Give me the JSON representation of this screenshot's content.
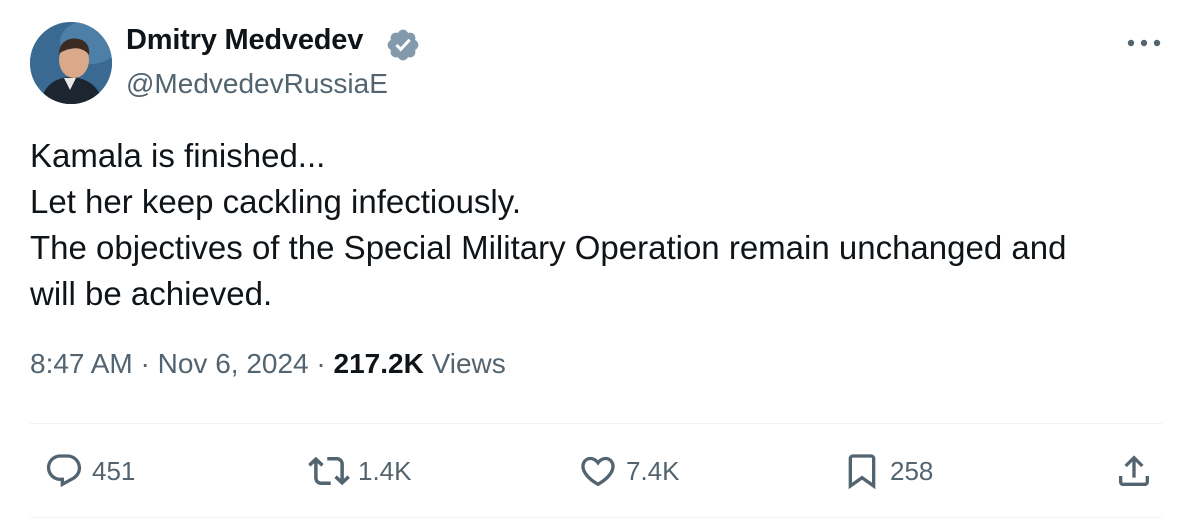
{
  "author": {
    "name": "Dmitry Medvedev",
    "handle": "@MedvedevRussiaE",
    "verified": true,
    "avatar_icon": "profile-photo"
  },
  "tweet": {
    "lines": [
      "Kamala is finished...",
      "Let her keep cackling infectiously.",
      "The objectives of the Special Military Operation remain unchanged and",
      "will be achieved."
    ]
  },
  "meta": {
    "time": "8:47 AM",
    "separator": "·",
    "date": "Nov 6, 2024",
    "views_count": "217.2K",
    "views_label": "Views"
  },
  "actions": {
    "replies": "451",
    "reposts": "1.4K",
    "likes": "7.4K",
    "bookmarks": "258"
  },
  "colors": {
    "text": "#0f1419",
    "secondary": "#536471",
    "verified_badge": "#829aab",
    "divider": "#eff3f4"
  }
}
